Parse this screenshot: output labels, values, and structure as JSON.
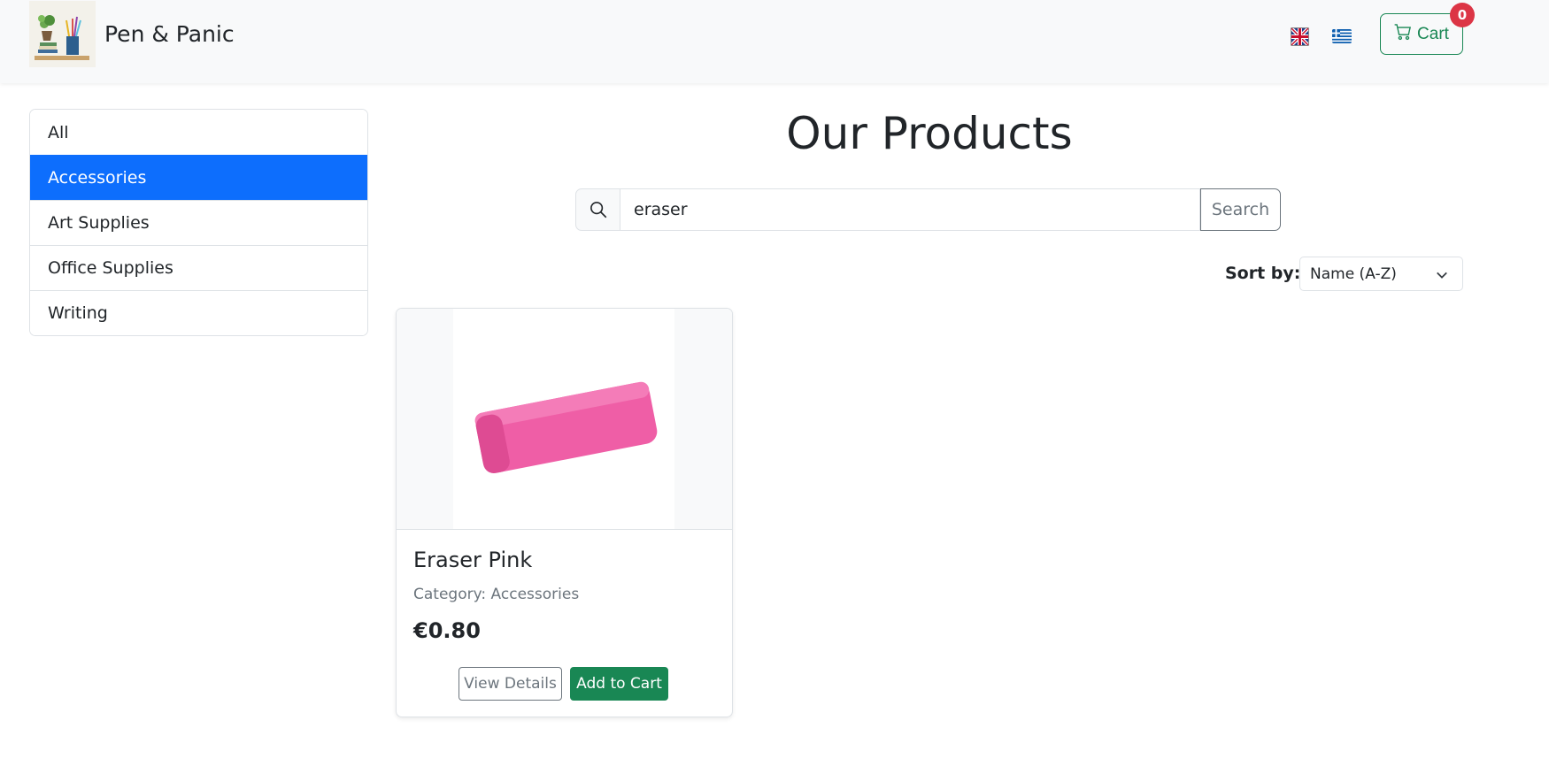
{
  "header": {
    "brand": "Pen & Panic",
    "logo_icon": "stationery-shelf-logo",
    "languages": [
      {
        "code": "en",
        "icon": "uk-flag-icon"
      },
      {
        "code": "el",
        "icon": "greek-flag-icon"
      }
    ],
    "cart": {
      "label": "Cart",
      "count": "0",
      "icon": "cart-icon"
    }
  },
  "sidebar": {
    "items": [
      {
        "label": "All",
        "active": false
      },
      {
        "label": "Accessories",
        "active": true
      },
      {
        "label": "Art Supplies",
        "active": false
      },
      {
        "label": "Office Supplies",
        "active": false
      },
      {
        "label": "Writing",
        "active": false
      }
    ]
  },
  "main": {
    "title": "Our Products",
    "search": {
      "value": "eraser",
      "button_label": "Search",
      "icon": "search-icon"
    },
    "sort": {
      "label": "Sort by:",
      "selected": "Name (A-Z)"
    },
    "products": [
      {
        "name": "Eraser Pink",
        "category": "Category: Accessories",
        "price": "€0.80",
        "view_label": "View Details",
        "add_label": "Add to Cart",
        "image": "pink-eraser-image"
      }
    ]
  },
  "colors": {
    "primary": "#0d6efd",
    "success": "#198754",
    "danger": "#dc3545",
    "navbar_bg": "#f8f9fa",
    "muted": "#6c757d"
  }
}
